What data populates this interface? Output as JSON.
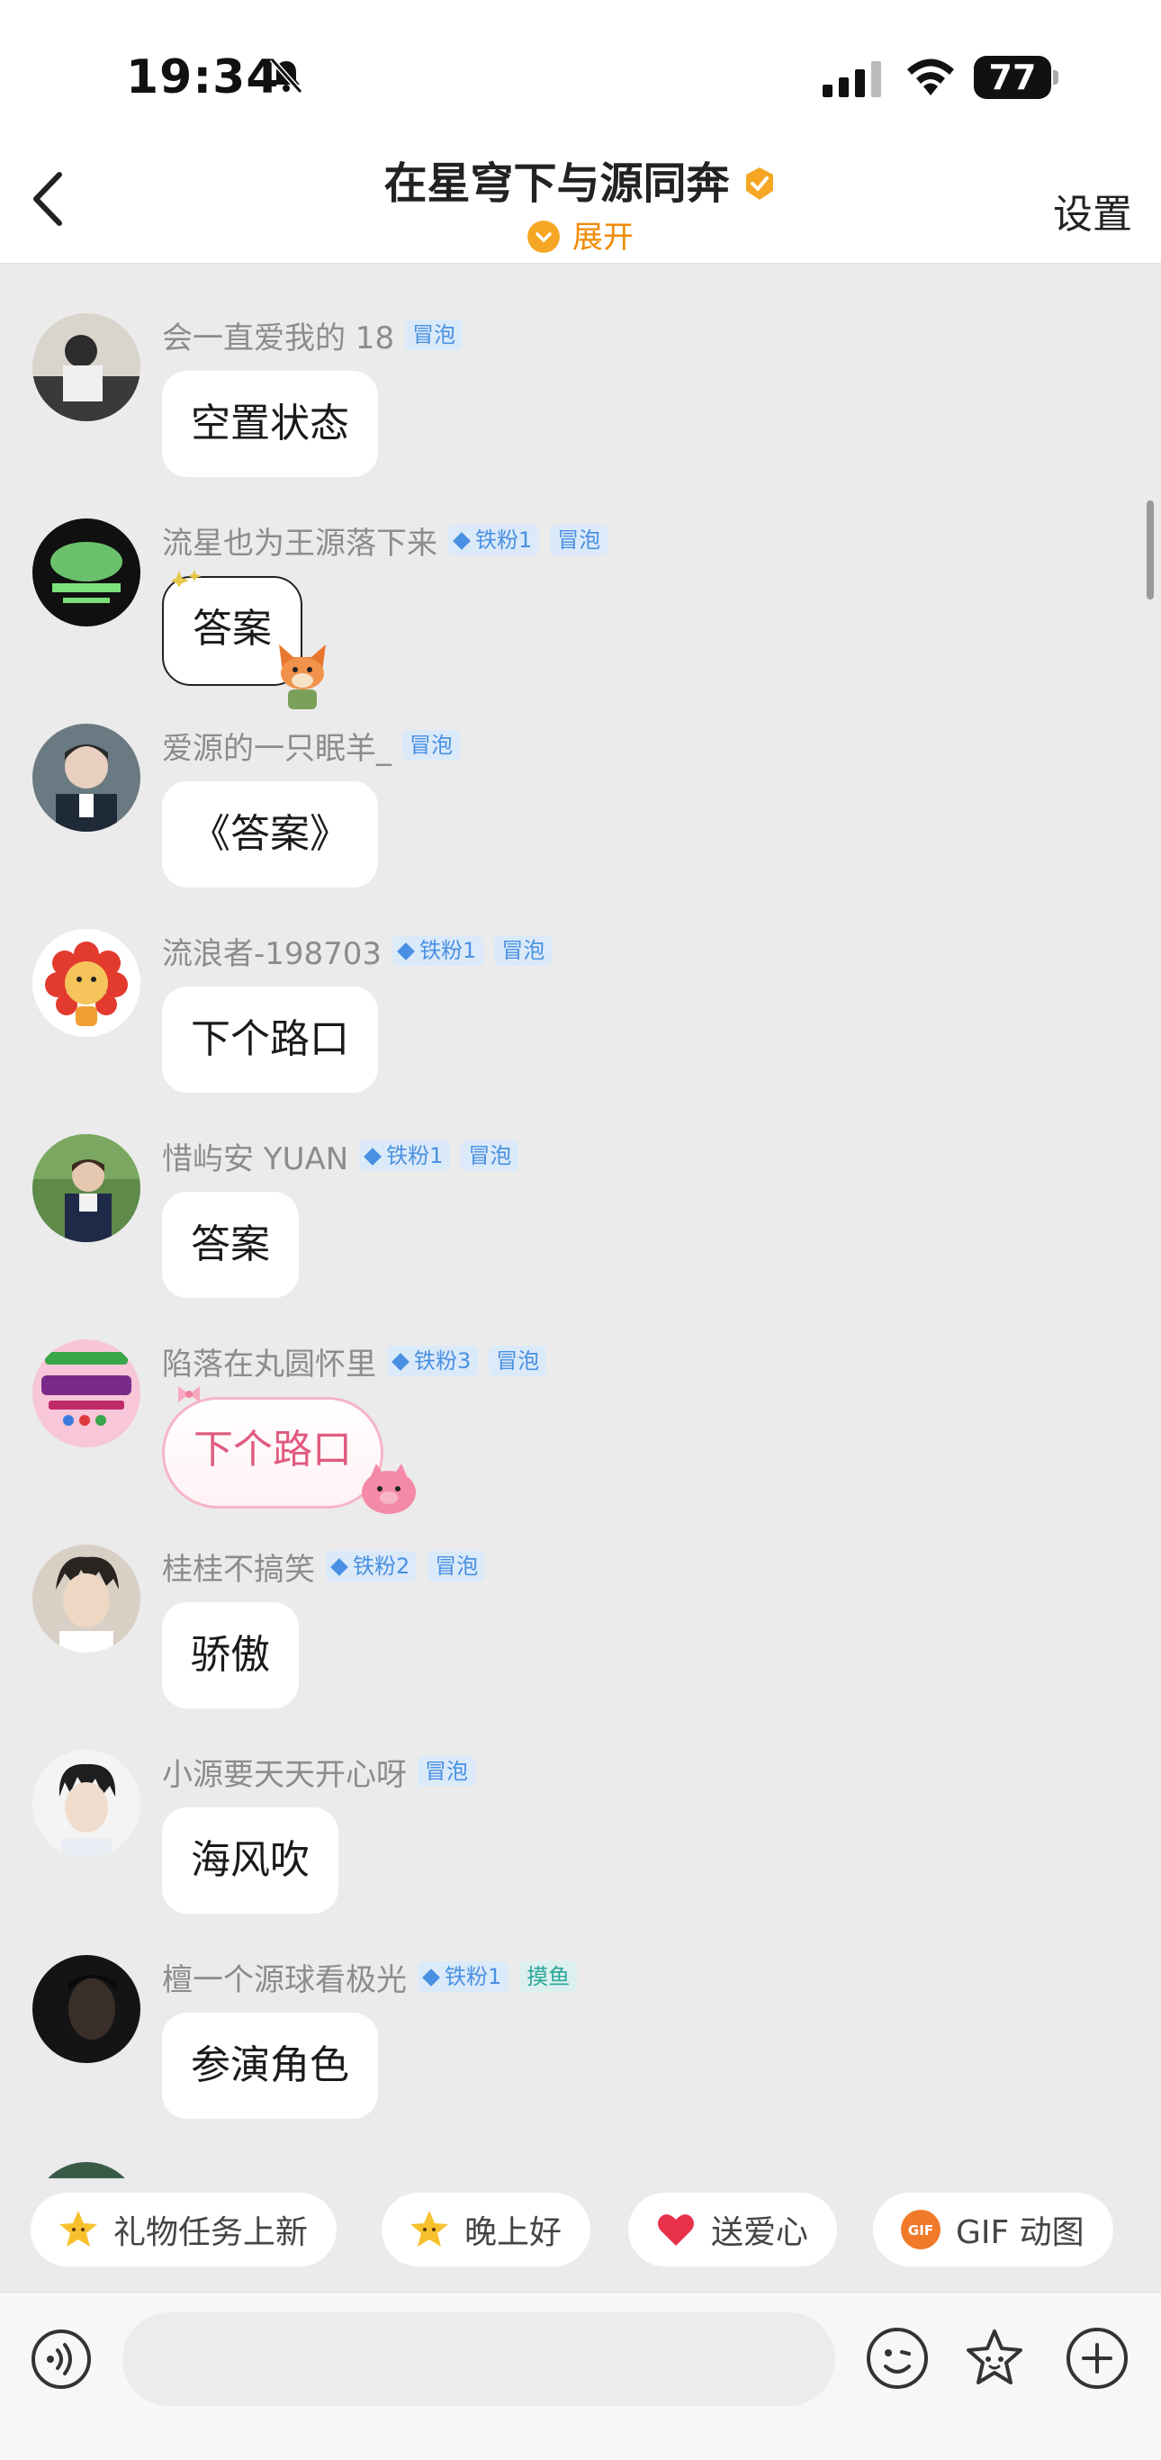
{
  "status": {
    "time": "19:34",
    "battery": "77"
  },
  "nav": {
    "title": "在星穹下与源同奔",
    "expand_label": "展开",
    "settings_label": "设置"
  },
  "messages": [
    {
      "username": "会一直爱我的 18",
      "badges": [
        "冒泡"
      ],
      "text": "空置状态"
    },
    {
      "username": "流星也为王源落下来",
      "badges": [
        "铁粉1",
        "冒泡"
      ],
      "text": "答案"
    },
    {
      "username": "爱源的一只眠羊_",
      "badges": [
        "冒泡"
      ],
      "text": "《答案》"
    },
    {
      "username": "流浪者-198703",
      "badges": [
        "铁粉1",
        "冒泡"
      ],
      "text": "下个路口"
    },
    {
      "username": "惜屿安 YUAN",
      "badges": [
        "铁粉1",
        "冒泡"
      ],
      "text": "答案"
    },
    {
      "username": "陷落在丸圆怀里",
      "badges": [
        "铁粉3",
        "冒泡"
      ],
      "text": "下个路口"
    },
    {
      "username": "桂桂不搞笑",
      "badges": [
        "铁粉2",
        "冒泡"
      ],
      "text": "骄傲"
    },
    {
      "username": "小源要天天开心呀",
      "badges": [
        "冒泡"
      ],
      "text": "海风吹"
    },
    {
      "username": "檀一个源球看极光",
      "badges": [
        "铁粉1",
        "摸鱼"
      ],
      "text": "参演角色"
    }
  ],
  "quick_replies": [
    {
      "label": "礼物任务上新",
      "icon": "star-face-icon"
    },
    {
      "label": "晚上好",
      "icon": "star-face-icon"
    },
    {
      "label": "送爱心",
      "icon": "heart-icon"
    },
    {
      "label": "GIF 动图",
      "icon": "gif-icon",
      "icon_text": "GIF"
    }
  ],
  "input": {
    "placeholder": ""
  },
  "colors": {
    "accent": "#f08a00",
    "badge_blue": "#4a90e2",
    "badge_teal": "#2ba79a",
    "pink_bubble": "#e05b80"
  }
}
